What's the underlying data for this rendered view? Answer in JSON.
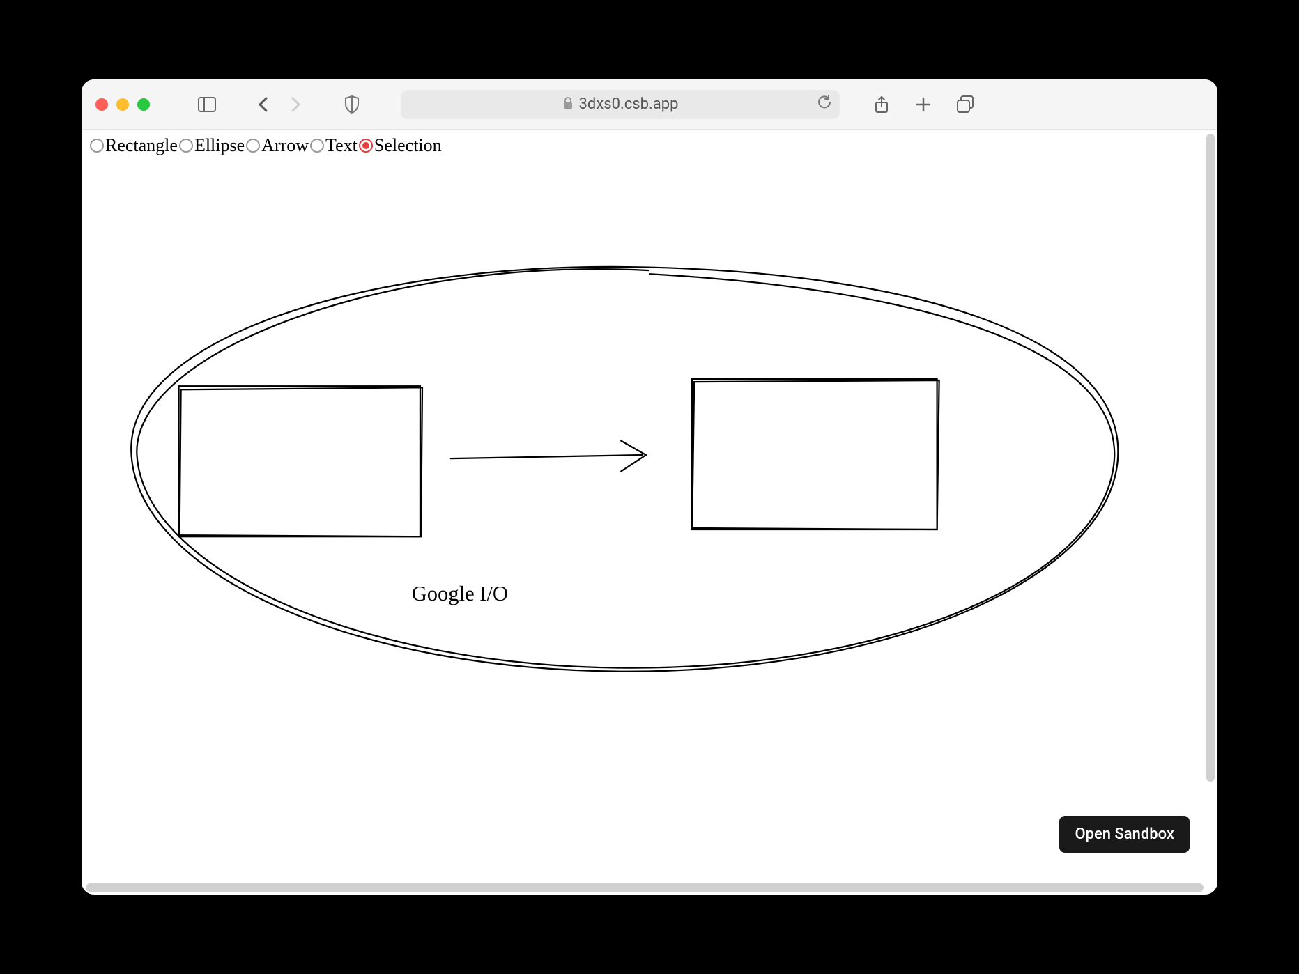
{
  "browser": {
    "url_display": "3dxs0.csb.app"
  },
  "tools": [
    {
      "label": "Rectangle",
      "selected": false
    },
    {
      "label": "Ellipse",
      "selected": false
    },
    {
      "label": "Arrow",
      "selected": false
    },
    {
      "label": "Text",
      "selected": false
    },
    {
      "label": "Selection",
      "selected": true
    }
  ],
  "canvas": {
    "text_label": "Google I/O"
  },
  "sandbox_button": "Open Sandbox"
}
